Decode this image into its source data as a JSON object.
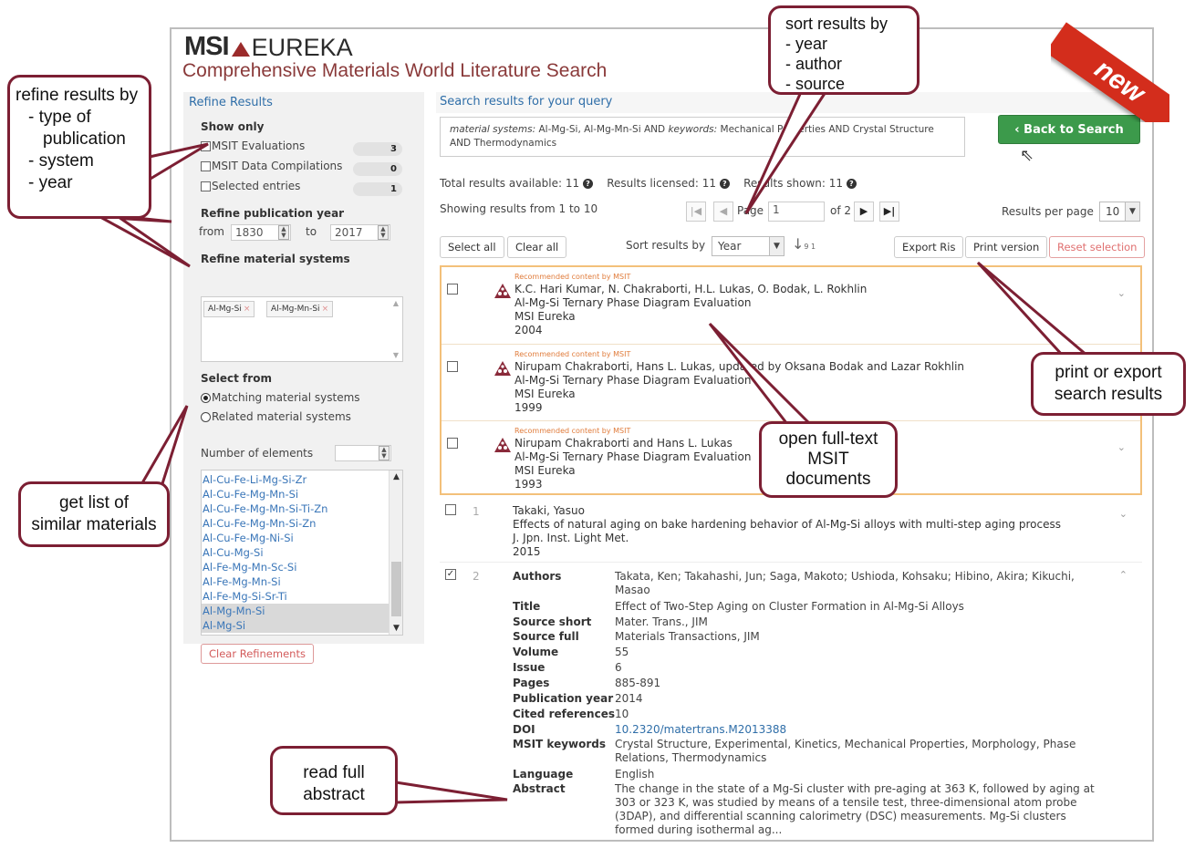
{
  "header": {
    "logo_msi": "MSI",
    "logo_eureka": "EUREKA",
    "subtitle": "Comprehensive Materials World Literature Search",
    "ribbon": "new"
  },
  "refine": {
    "title": "Refine Results",
    "show_only_label": "Show only",
    "show_only": [
      {
        "label": "MSIT Evaluations",
        "count": "3"
      },
      {
        "label": "MSIT Data Compilations",
        "count": "0"
      },
      {
        "label": "Selected entries",
        "count": "1"
      }
    ],
    "year_label": "Refine publication year",
    "from_label": "from",
    "from_value": "1830",
    "to_label": "to",
    "to_value": "2017",
    "systems_label": "Refine material systems",
    "system_tags": [
      "Al-Mg-Si",
      "Al-Mg-Mn-Si"
    ],
    "tag_remove": "×",
    "select_from_label": "Select from",
    "radio_matching": "Matching material systems",
    "radio_related": "Related material systems",
    "elements_label": "Number of elements",
    "material_list": [
      "Al-Cu-Fe-Li-Mg-Si-Zr",
      "Al-Cu-Fe-Mg-Mn-Si",
      "Al-Cu-Fe-Mg-Mn-Si-Ti-Zn",
      "Al-Cu-Fe-Mg-Mn-Si-Zn",
      "Al-Cu-Fe-Mg-Ni-Si",
      "Al-Cu-Mg-Si",
      "Al-Fe-Mg-Mn-Sc-Si",
      "Al-Fe-Mg-Mn-Si",
      "Al-Fe-Mg-Si-Sr-Ti",
      "Al-Mg-Mn-Si",
      "Al-Mg-Si"
    ],
    "clear_button": "Clear Refinements"
  },
  "results": {
    "title": "Search results for your query",
    "query_prefix_1": "material systems:",
    "query_systems": " Al-Mg-Si, Al-Mg-Mn-Si AND ",
    "query_prefix_2": "keywords:",
    "query_keywords": " Mechanical Properties AND Crystal Structure",
    "query_line2": "AND Thermodynamics",
    "back_button": "‹ Back to Search",
    "total": "Total results available: 11",
    "licensed": "Results licensed: 11",
    "shown": "Results shown: 11",
    "info_icon": "?",
    "showing": "Showing results from 1 to 10",
    "page_label": "Page",
    "page_value": "1",
    "of_pages": "of 2",
    "per_page_label": "Results per page",
    "per_page_value": "10",
    "select_all": "Select all",
    "clear_all": "Clear all",
    "sort_label": "Sort results by",
    "sort_value": "Year",
    "sort_icon": "↓",
    "sort_icon_digits": "9 1",
    "export_ris": "Export Ris",
    "print_version": "Print version",
    "reset_selection": "Reset selection"
  },
  "recommended_label": "Recommended content by MSIT",
  "recommended": [
    {
      "authors": "K.C. Hari Kumar, N. Chakraborti, H.L. Lukas, O. Bodak, L. Rokhlin",
      "title": "Al-Mg-Si Ternary Phase Diagram Evaluation",
      "source": "MSI Eureka",
      "year": "2004"
    },
    {
      "authors": "Nirupam Chakraborti, Hans L. Lukas, updated by Oksana Bodak and Lazar Rokhlin",
      "title": "Al-Mg-Si Ternary Phase Diagram Evaluation",
      "source": "MSI Eureka",
      "year": "1999"
    },
    {
      "authors": "Nirupam Chakraborti and Hans L. Lukas",
      "title": "Al-Mg-Si Ternary Phase Diagram Evaluation",
      "source": "MSI Eureka",
      "year": "1993"
    }
  ],
  "result1": {
    "num": "1",
    "authors": "Takaki, Yasuo",
    "title": "Effects of natural aging on bake hardening behavior of Al-Mg-Si alloys with multi-step aging process",
    "source": "J. Jpn. Inst. Light Met.",
    "year": "2015"
  },
  "result2": {
    "num": "2",
    "check": "✓",
    "fields": {
      "authors_label": "Authors",
      "authors": "Takata, Ken; Takahashi, Jun; Saga, Makoto; Ushioda, Kohsaku; Hibino, Akira; Kikuchi, Masao",
      "title_label": "Title",
      "title": "Effect of Two-Step Aging on Cluster Formation in Al-Mg-Si Alloys",
      "source_short_label": "Source short",
      "source_short": "Mater. Trans., JIM",
      "source_full_label": "Source full",
      "source_full": "Materials Transactions, JIM",
      "volume_label": "Volume",
      "volume": "55",
      "issue_label": "Issue",
      "issue": "6",
      "pages_label": "Pages",
      "pages": "885-891",
      "pubyear_label": "Publication year",
      "pubyear": "2014",
      "cited_label": "Cited references",
      "cited": "10",
      "doi_label": "DOI",
      "doi": "10.2320/matertrans.M2013388",
      "keywords_label": "MSIT keywords",
      "keywords": "Crystal Structure, Experimental, Kinetics, Mechanical Properties, Morphology, Phase Relations, Thermodynamics",
      "language_label": "Language",
      "language": "English",
      "abstract_label": "Abstract",
      "abstract": "The change in the state of a Mg-Si cluster with pre-aging at 363 K, followed by aging at 303 or 323 K, was studied by means of a tensile test, three-dimensional atom probe (3DAP), and differential scanning calorimetry (DSC) measurements. Mg-Si clusters formed during isothermal ag..."
    }
  },
  "callouts": {
    "refine": {
      "l1": "refine results by",
      "l2": "- type of",
      "l3": "publication",
      "l4": "- system",
      "l5": "- year"
    },
    "similar": {
      "l1": "get list of",
      "l2": "similar materials"
    },
    "sort": {
      "l1": "sort results by",
      "l2": "- year",
      "l3": "- author",
      "l4": "- source"
    },
    "export": {
      "l1": "print or export",
      "l2": "search results"
    },
    "fulltext": {
      "l1": "open full-text",
      "l2": "MSIT",
      "l3": "documents"
    },
    "abstract": {
      "l1": "read full",
      "l2": "abstract"
    }
  },
  "colors": {
    "accent": "#2f6ea8",
    "callout_border": "#7c1f33",
    "back_button": "#3c9a4b",
    "recommended_border": "#f3c07a",
    "ribbon": "#d32d1c"
  }
}
